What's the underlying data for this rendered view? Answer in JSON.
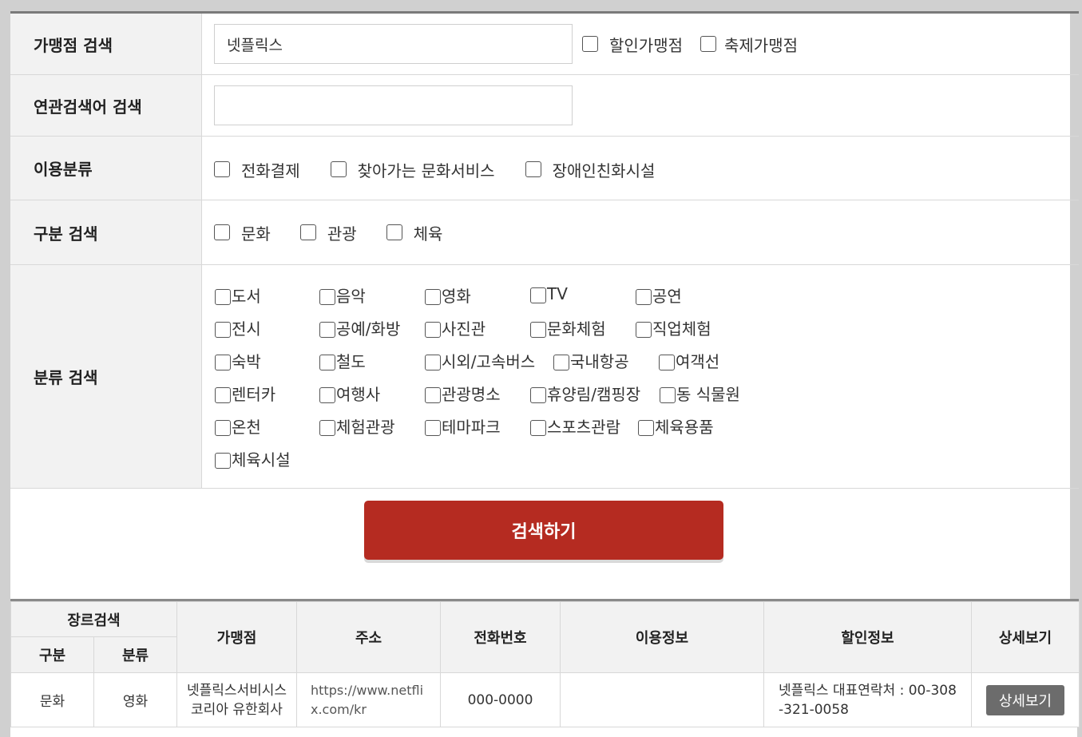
{
  "form": {
    "store_search": {
      "label": "가맹점 검색",
      "value": "넷플릭스",
      "options": [
        "할인가맹점",
        "축제가맹점"
      ]
    },
    "related_search": {
      "label": "연관검색어 검색",
      "value": ""
    },
    "usage": {
      "label": "이용분류",
      "options": [
        "전화결제",
        "찾아가는 문화서비스",
        "장애인친화시설"
      ]
    },
    "division": {
      "label": "구분 검색",
      "options": [
        "문화",
        "관광",
        "체육"
      ]
    },
    "category": {
      "label": "분류 검색",
      "rows": [
        [
          "도서",
          "음악",
          "영화",
          "TV",
          "공연"
        ],
        [
          "전시",
          "공예/화방",
          "사진관",
          "문화체험",
          "직업체험"
        ],
        [
          "숙박",
          "철도",
          "시외/고속버스",
          "국내항공",
          "여객선"
        ],
        [
          "렌터카",
          "여행사",
          "관광명소",
          "휴양림/캠핑장",
          "동 식물원"
        ],
        [
          "온천",
          "체험관광",
          "테마파크",
          "스포츠관람",
          "체육용품"
        ],
        [
          "체육시설"
        ]
      ]
    },
    "search_button": "검색하기"
  },
  "table": {
    "headers": {
      "genre": "장르검색",
      "division": "구분",
      "category": "분류",
      "store": "가맹점",
      "address": "주소",
      "phone": "전화번호",
      "usage_info": "이용정보",
      "discount_info": "할인정보",
      "detail": "상세보기"
    },
    "rows": [
      {
        "division": "문화",
        "category": "영화",
        "store": "넷플릭스서비시스코리아 유한회사",
        "address": "https://www.netflix.com/kr",
        "phone": "000-0000",
        "usage_info": "",
        "discount_info": "넷플릭스 대표연락처 : 00-308-321-0058",
        "detail_button": "상세보기"
      }
    ]
  },
  "colors": {
    "primary": "#b52b21",
    "detail_button": "#6c6c6c",
    "label_bg": "#f2f2f2"
  }
}
